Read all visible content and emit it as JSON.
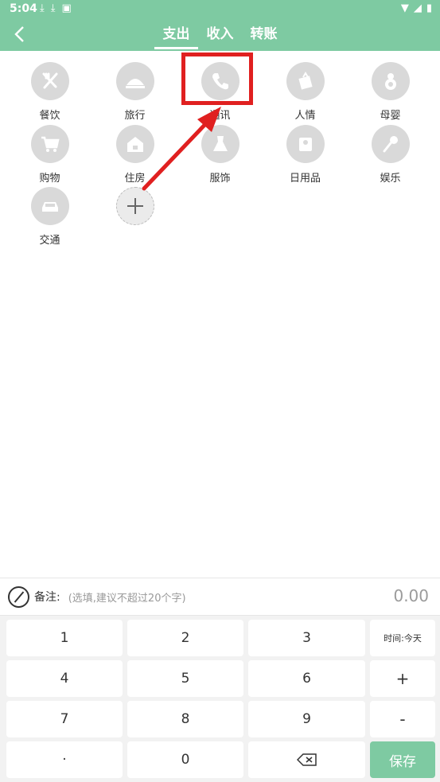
{
  "status": {
    "time": "5:04"
  },
  "header": {
    "tabs": [
      {
        "label": "支出",
        "active": true
      },
      {
        "label": "收入",
        "active": false
      },
      {
        "label": "转账",
        "active": false
      }
    ]
  },
  "categories": [
    {
      "label": "餐饮",
      "icon": "utensils-icon"
    },
    {
      "label": "旅行",
      "icon": "travel-icon"
    },
    {
      "label": "通讯",
      "icon": "phone-icon"
    },
    {
      "label": "人情",
      "icon": "gift-icon"
    },
    {
      "label": "母婴",
      "icon": "baby-icon"
    },
    {
      "label": "购物",
      "icon": "cart-icon"
    },
    {
      "label": "住房",
      "icon": "house-icon"
    },
    {
      "label": "服饰",
      "icon": "dress-icon"
    },
    {
      "label": "日用品",
      "icon": "tissue-icon"
    },
    {
      "label": "娱乐",
      "icon": "microphone-icon"
    },
    {
      "label": "交通",
      "icon": "car-icon"
    }
  ],
  "note": {
    "label": "备注:",
    "placeholder": "(选填,建议不超过20个字)",
    "amount": "0.00"
  },
  "keypad": {
    "k1": "1",
    "k2": "2",
    "k3": "3",
    "time": "时间:今天",
    "k4": "4",
    "k5": "5",
    "k6": "6",
    "plus": "+",
    "k7": "7",
    "k8": "8",
    "k9": "9",
    "minus": "-",
    "dot": "·",
    "k0": "0",
    "save": "保存"
  },
  "colors": {
    "accent": "#7ecaa2",
    "annotation": "#e02020",
    "icon_circle": "#d9d9d9"
  }
}
